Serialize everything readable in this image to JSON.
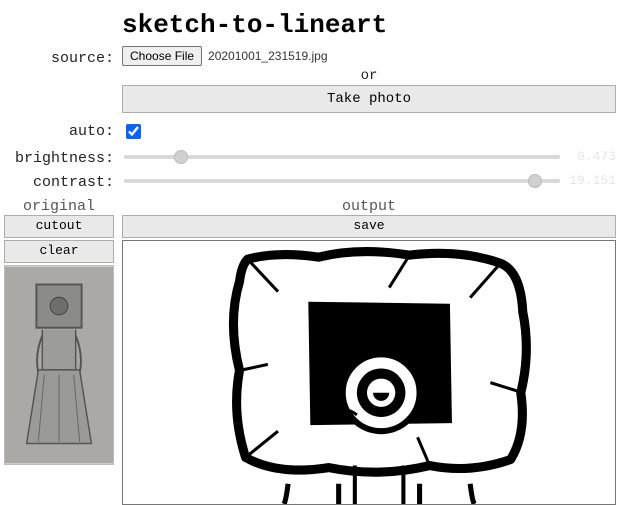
{
  "title": "sketch-to-lineart",
  "labels": {
    "source": "source:",
    "auto": "auto:",
    "brightness": "brightness:",
    "contrast": "contrast:",
    "original": "original",
    "output": "output"
  },
  "file": {
    "choose_label": "Choose File",
    "filename": "20201001_231519.jpg",
    "or_label": "or",
    "take_photo_label": "Take photo"
  },
  "auto_checked": true,
  "sliders": {
    "brightness": {
      "value": 0.473,
      "display": "0.473",
      "min": 0,
      "max": 4,
      "step": 0.001
    },
    "contrast": {
      "value": 19.151,
      "display": "19.151",
      "min": 0,
      "max": 20,
      "step": 0.001
    }
  },
  "buttons": {
    "cutout": "cutout",
    "clear": "clear",
    "save": "save"
  },
  "colors": {
    "button_bg": "#e9e9e9",
    "button_border": "#adadad",
    "accent": "#0a62ff"
  }
}
